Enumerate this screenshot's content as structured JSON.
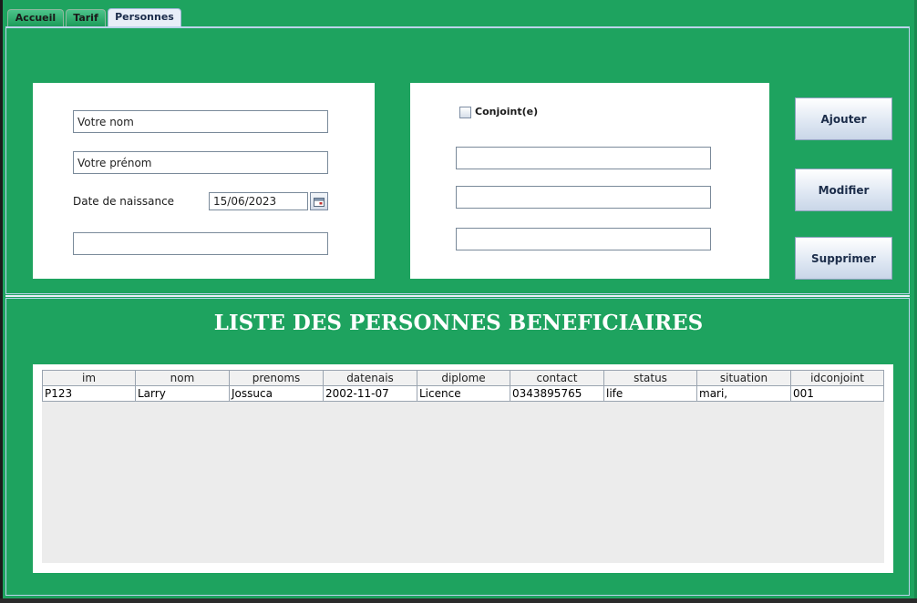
{
  "tabs": [
    {
      "label": "Accueil"
    },
    {
      "label": "Tarif"
    },
    {
      "label": "Personnes"
    }
  ],
  "form": {
    "nom": "Votre nom",
    "prenom": "Votre prénom",
    "date_label": "Date de naissance",
    "date_value": "15/06/2023",
    "extra_field": "",
    "calendar_icon": "calendar-icon"
  },
  "spouse": {
    "checkbox_label": "Conjoint(e)",
    "checked": false,
    "field1": "",
    "field2": "",
    "field3": ""
  },
  "actions": {
    "add": "Ajouter",
    "edit": "Modifier",
    "delete": "Supprimer"
  },
  "list": {
    "title": "LISTE DES PERSONNES BENEFICIAIRES",
    "columns": [
      "im",
      "nom",
      "prenoms",
      "datenais",
      "diplome",
      "contact",
      "status",
      "situation",
      "idconjoint"
    ],
    "rows": [
      [
        "P123",
        "Larry",
        "Jossuca",
        "2002-11-07",
        "Licence",
        "0343895765",
        "life",
        "mari,",
        "001"
      ]
    ]
  },
  "colors": {
    "background": "#1ea35f",
    "panel": "#ffffff",
    "active_tab": "#e8eef8"
  }
}
